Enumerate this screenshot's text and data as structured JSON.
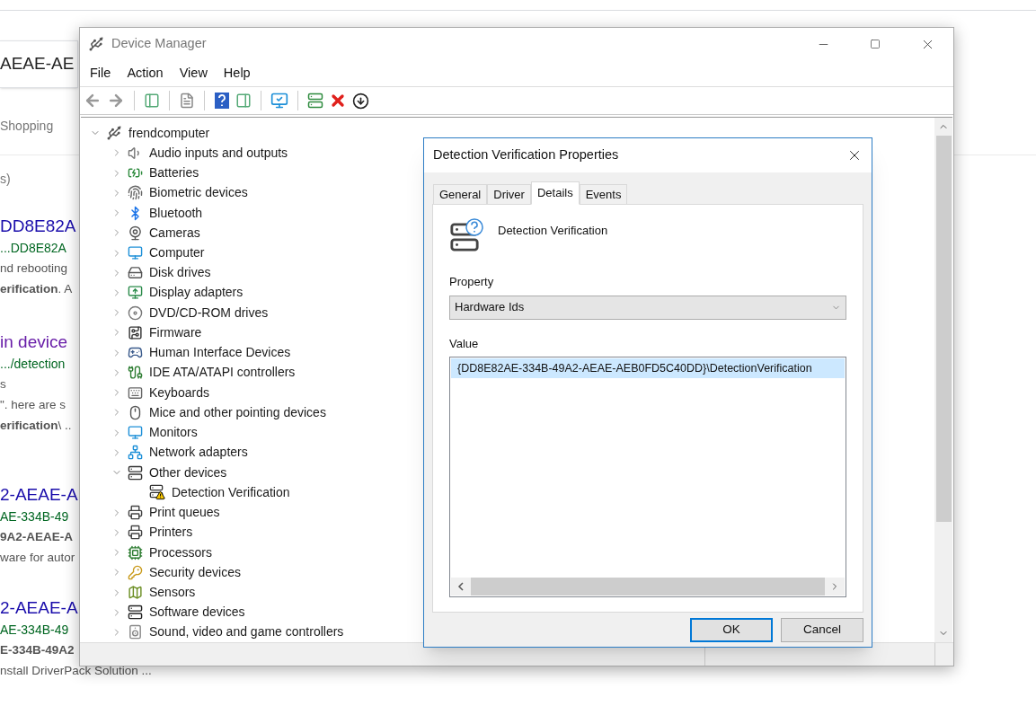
{
  "browser": {
    "search_value": "AEAE-AE",
    "tab": "Shopping",
    "result_stats": "s)",
    "results": [
      {
        "title": "DD8E82A",
        "visited": false,
        "url": "...DD8E82A",
        "snippet": [
          "nd rebooting",
          "**erification**. A"
        ]
      },
      {
        "title": "in device",
        "visited": true,
        "url": ".../detection",
        "snippet": [
          "s",
          "\". here are s",
          "**erification**\\ .."
        ]
      },
      {
        "title": "2-AEAE-A",
        "visited": false,
        "url": "AE-334B-49",
        "snippet": [
          "**9A2-AEAE-A**",
          "ware for autor"
        ]
      },
      {
        "title": "2-AEAE-A",
        "visited": false,
        "url": "AE-334B-49",
        "snippet": [
          "**E-334B-49A2**",
          "nstall DriverPack Solution ..."
        ]
      }
    ]
  },
  "device_manager": {
    "title": "Device Manager",
    "menu": [
      "File",
      "Action",
      "View",
      "Help"
    ],
    "tree": {
      "label": "frendcomputer",
      "expanded": true,
      "children": [
        {
          "label": "Audio inputs and outputs",
          "expanded": false
        },
        {
          "label": "Batteries",
          "expanded": false
        },
        {
          "label": "Biometric devices",
          "expanded": false
        },
        {
          "label": "Bluetooth",
          "expanded": false
        },
        {
          "label": "Cameras",
          "expanded": false
        },
        {
          "label": "Computer",
          "expanded": false
        },
        {
          "label": "Disk drives",
          "expanded": false
        },
        {
          "label": "Display adapters",
          "expanded": false
        },
        {
          "label": "DVD/CD-ROM drives",
          "expanded": false
        },
        {
          "label": "Firmware",
          "expanded": false
        },
        {
          "label": "Human Interface Devices",
          "expanded": false
        },
        {
          "label": "IDE ATA/ATAPI controllers",
          "expanded": false
        },
        {
          "label": "Keyboards",
          "expanded": false
        },
        {
          "label": "Mice and other pointing devices",
          "expanded": false
        },
        {
          "label": "Monitors",
          "expanded": false
        },
        {
          "label": "Network adapters",
          "expanded": false
        },
        {
          "label": "Other devices",
          "expanded": true,
          "children": [
            {
              "label": "Detection Verification",
              "warning": true
            }
          ]
        },
        {
          "label": "Print queues",
          "expanded": false
        },
        {
          "label": "Printers",
          "expanded": false
        },
        {
          "label": "Processors",
          "expanded": false
        },
        {
          "label": "Security devices",
          "expanded": false
        },
        {
          "label": "Sensors",
          "expanded": false
        },
        {
          "label": "Software devices",
          "expanded": false
        },
        {
          "label": "Sound, video and game controllers",
          "expanded": false
        }
      ]
    }
  },
  "dialog": {
    "title": "Detection Verification Properties",
    "tabs": [
      {
        "label": "General",
        "selected": false
      },
      {
        "label": "Driver",
        "selected": false
      },
      {
        "label": "Details",
        "selected": true
      },
      {
        "label": "Events",
        "selected": false
      }
    ],
    "device_name": "Detection Verification",
    "property_label": "Property",
    "property_value": "Hardware Ids",
    "value_label": "Value",
    "values": [
      {
        "text": "{DD8E82AE-334B-49A2-AEAE-AEB0FD5C40DD}\\DetectionVerification",
        "selected": true
      }
    ],
    "buttons": [
      {
        "label": "OK",
        "default": true
      },
      {
        "label": "Cancel",
        "default": false
      }
    ]
  }
}
